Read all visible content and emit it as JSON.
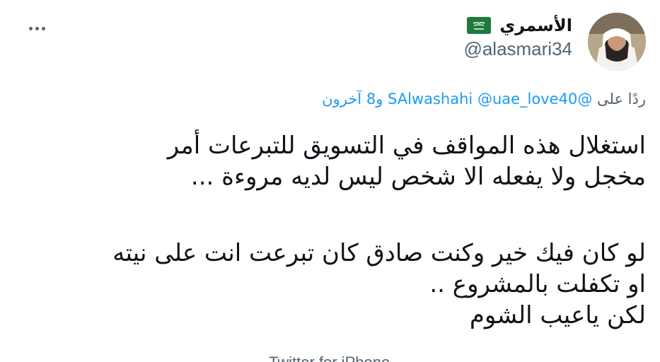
{
  "author": {
    "display_name": "الأسمري",
    "handle": "@alasmari34",
    "flag_icon": "saudi-flag-icon",
    "avatar_icon": "profile-photo"
  },
  "more_icon": "more-horizontal-icon",
  "reply": {
    "prefix": "ردًا على",
    "mentions": [
      "@SAlwashahi",
      "@uae_love40"
    ],
    "others": "و8 آخرون"
  },
  "tweet": {
    "lines": [
      "استغلال هذه المواقف في التسويق للتبرعات أمر",
      "مخجل ولا يفعله الا شخص ليس لديه مروءة ...",
      "لو كان فيك خير وكنت صادق كان تبرعت انت على نيته",
      "او تكفلت بالمشروع ..",
      "لكن ياعيب الشوم"
    ]
  },
  "source": "Twitter for iPhone",
  "colors": {
    "link": "#1d9bf0",
    "secondary_text": "#536471",
    "primary_text": "#0f1419",
    "flag_green": "#1f7a3c"
  }
}
